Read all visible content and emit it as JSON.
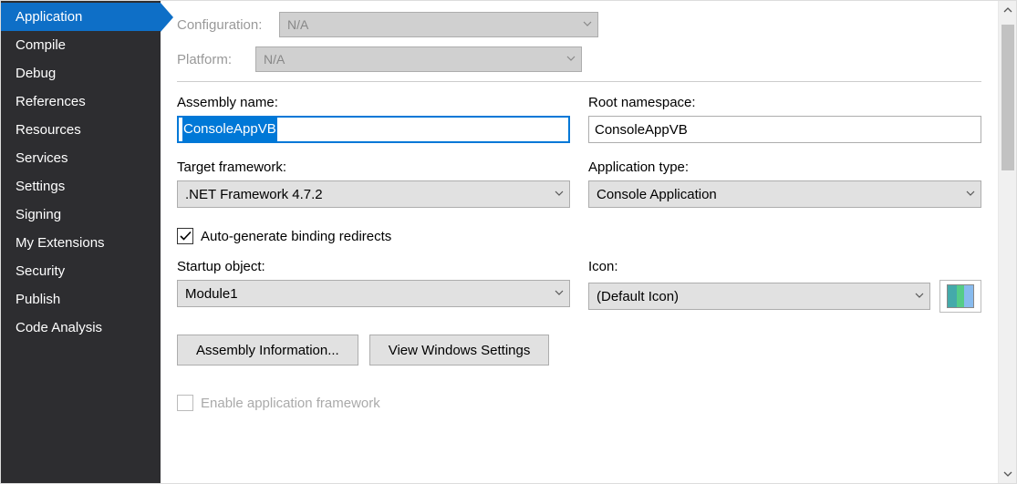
{
  "sidebar": {
    "items": [
      {
        "label": "Application",
        "active": true
      },
      {
        "label": "Compile"
      },
      {
        "label": "Debug"
      },
      {
        "label": "References"
      },
      {
        "label": "Resources"
      },
      {
        "label": "Services"
      },
      {
        "label": "Settings"
      },
      {
        "label": "Signing"
      },
      {
        "label": "My Extensions"
      },
      {
        "label": "Security"
      },
      {
        "label": "Publish"
      },
      {
        "label": "Code Analysis"
      }
    ]
  },
  "config": {
    "configuration_label": "Configuration:",
    "configuration_value": "N/A",
    "platform_label": "Platform:",
    "platform_value": "N/A"
  },
  "form": {
    "assembly_name_label": "Assembly name:",
    "assembly_name_value": "ConsoleAppVB",
    "root_namespace_label": "Root namespace:",
    "root_namespace_value": "ConsoleAppVB",
    "target_framework_label": "Target framework:",
    "target_framework_value": ".NET Framework 4.7.2",
    "application_type_label": "Application type:",
    "application_type_value": "Console Application",
    "auto_generate_label": "Auto-generate binding redirects",
    "startup_object_label": "Startup object:",
    "startup_object_value": "Module1",
    "icon_label": "Icon:",
    "icon_value": "(Default Icon)",
    "assembly_info_btn": "Assembly Information...",
    "view_windows_btn": "View Windows Settings",
    "enable_app_framework_label": "Enable application framework"
  }
}
